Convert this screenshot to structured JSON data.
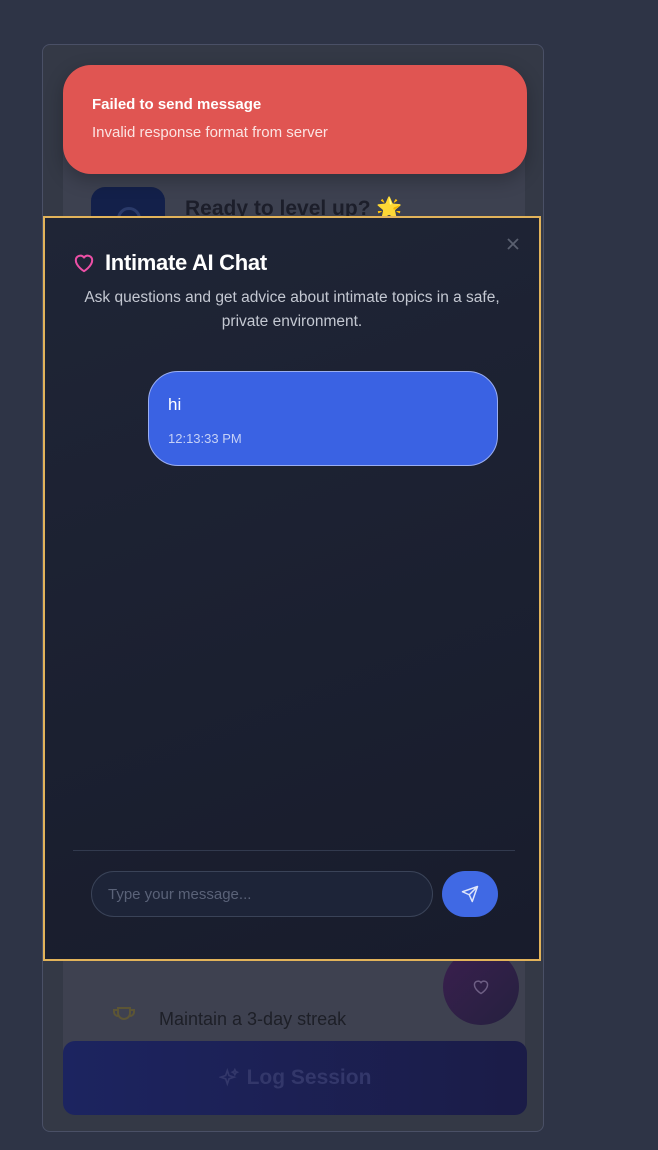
{
  "background": {
    "level_up_text": "Ready to level up? 🌟",
    "streak_text": "Maintain a 3-day streak",
    "log_session_label": "Log Session"
  },
  "toast": {
    "title": "Failed to send message",
    "message": "Invalid response format from server",
    "color": "#e05552"
  },
  "dialog": {
    "title": "Intimate AI Chat",
    "description": "Ask questions and get advice about intimate topics in a safe, private environment.",
    "title_icon": "heart-icon",
    "close_icon": "close-icon",
    "border_color": "#e2b35a",
    "messages": [
      {
        "text": "hi",
        "time": "12:13:33 PM",
        "sender": "user"
      }
    ],
    "input": {
      "placeholder": "Type your message...",
      "value": ""
    },
    "send_icon": "send-icon"
  }
}
